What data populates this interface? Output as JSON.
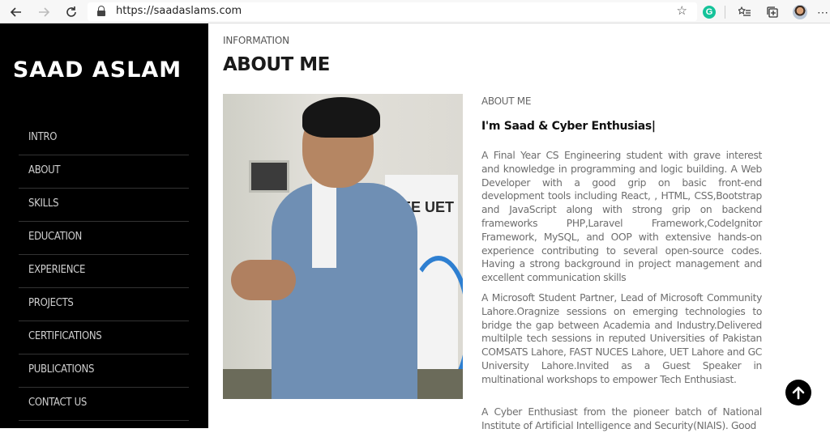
{
  "browser": {
    "url": "https://saadaslams.com"
  },
  "sidebar": {
    "brand": "SAAD ASLAM",
    "items": [
      {
        "label": "INTRO"
      },
      {
        "label": "ABOUT"
      },
      {
        "label": "SKILLS"
      },
      {
        "label": "EDUCATION"
      },
      {
        "label": "EXPERIENCE"
      },
      {
        "label": "PROJECTS"
      },
      {
        "label": "CERTIFICATIONS"
      },
      {
        "label": "PUBLICATIONS"
      },
      {
        "label": "CONTACT US"
      }
    ]
  },
  "main": {
    "section_label": "INFORMATION",
    "title": "ABOUT ME",
    "photo_banner_text": "EE UET",
    "about_sub": "ABOUT ME",
    "tagline": "I'm Saad & Cyber Enthusias|",
    "paragraphs": [
      "A Final Year CS Engineering student with grave interest and knowledge in programming and logic building. A Web Developer with a good grip on basic front-end development tools including React, , HTML, CSS,Bootstrap and JavaScript along with strong grip on backend frameworks PHP,Laravel Framework,CodeIgnitor Framework, MySQL, and OOP with extensive hands-on experience contributing to several open-source codes. Having a strong background in project management and excellent communication skills",
      "A Microsoft Student Partner, Lead of Microsoft Community Lahore.Oragnize sessions on emerging technologies to bridge the gap between Academia and Industry.Delivered multilple tech sessions in reputed Universities of Pakistan COMSATS Lahore, FAST NUCES Lahore, UET Lahore and GC University Lahore.Invited as a Guest Speaker in multinational workshops to empower Tech Enthusiast.",
      "A Cyber Enthusiast from the pioneer batch of National Institute of Artificial Intelligence and Security(NIAIS). Good"
    ]
  }
}
